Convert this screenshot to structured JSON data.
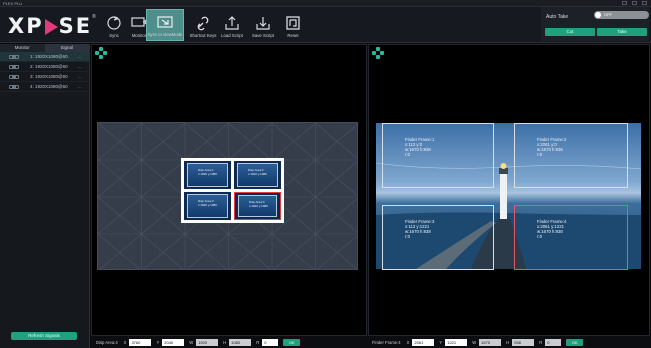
{
  "window": {
    "title": "PLEX PLU"
  },
  "logo": {
    "text_before": "X",
    "text_after": "SE",
    "text_mid": "P",
    "reg": "®"
  },
  "toolbar": {
    "items": [
      {
        "label": "Sync",
        "icon": "sync-icon"
      },
      {
        "label": "Monitor",
        "icon": "monitor-icon"
      },
      {
        "label": "Sync to viewMode",
        "icon": "sync-to-viewmode-icon"
      },
      {
        "label": "Shortcut Keys",
        "icon": "shortcut-keys-icon"
      },
      {
        "label": "Load Script",
        "icon": "load-script-icon"
      },
      {
        "label": "Save Script",
        "icon": "save-script-icon"
      },
      {
        "label": "Reset",
        "icon": "reset-icon"
      }
    ],
    "active_index": 2
  },
  "auto_take": {
    "label": "Auto Take",
    "toggle_text": "OFF",
    "cut_label": "Cut",
    "take_label": "Take"
  },
  "left_panel": {
    "tabs": [
      "Monitor",
      "Signal"
    ],
    "active_tab": "Signal",
    "signals": [
      {
        "label": "1: 1920X1080@60",
        "dots": "..."
      },
      {
        "label": "2: 1920X1080@60",
        "dots": "..."
      },
      {
        "label": "3: 1920X1080@60",
        "dots": "..."
      },
      {
        "label": "4: 1920X1080@60",
        "dots": "..."
      }
    ],
    "refresh_label": "Refresh Signals"
  },
  "display_areas": [
    {
      "t1": "Disp Area:1",
      "t2": "x:1920  y:1080"
    },
    {
      "t1": "Disp Area:2",
      "t2": "x:1920  y:1080"
    },
    {
      "t1": "Disp Area:3",
      "t2": "x:1920  y:1080"
    },
    {
      "t1": "Disp Area:4",
      "t2": "x:1920  y:1080"
    }
  ],
  "finder_frames": [
    {
      "a": "Finder Frame:1",
      "b": "x:113  y:0",
      "c": "w:1670  h:938",
      "d": "r:0"
    },
    {
      "a": "Finder Frame:2",
      "b": "x:2061  y:0",
      "c": "w:1670  h:938",
      "d": "r:0"
    },
    {
      "a": "Finder Frame:3",
      "b": "x:113  y:1221",
      "c": "w:1670  h:938",
      "d": "r:0"
    },
    {
      "a": "Finder Frame:4",
      "b": "x:2061  y:1221",
      "c": "w:1670  h:938",
      "d": "r:0"
    }
  ],
  "bottom_left": {
    "title": "Disp Area:4",
    "x_label": "X",
    "x_val": "3760",
    "y_label": "Y",
    "y_val": "2040",
    "w_label": "W",
    "w_val": "1920",
    "h_label": "H",
    "h_val": "1080",
    "r_label": "R",
    "r_val": "0",
    "ok": "OK"
  },
  "bottom_right": {
    "title": "Finder Frame:4",
    "x_label": "X",
    "x_val": "2061",
    "y_label": "Y",
    "y_val": "1221",
    "w_label": "W",
    "w_val": "1670",
    "h_label": "H",
    "h_val": "938",
    "r_label": "R",
    "r_val": "0",
    "ok": "OK"
  },
  "colors": {
    "accent": "#1fa07e",
    "active_tool": "#4e8f8c",
    "display_frame": "#ffffff",
    "grid": "#353c4a"
  }
}
